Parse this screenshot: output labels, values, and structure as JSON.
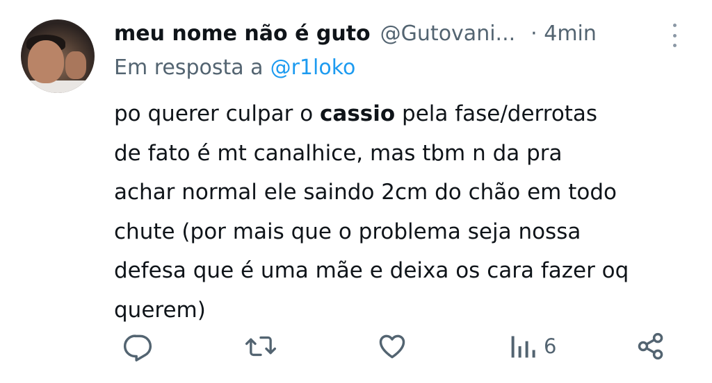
{
  "tweet": {
    "author_name": "meu nome não é guto",
    "author_handle": "@Gutovani...",
    "time": "· 4min",
    "reply_prefix": "Em resposta a",
    "reply_to": "@r1loko",
    "text_lines": [
      {
        "parts": [
          {
            "t": "po querer culpar o ",
            "bold": false
          },
          {
            "t": "cassio",
            "bold": true
          },
          {
            "t": " pela fase/derrotas",
            "bold": false
          }
        ]
      },
      {
        "parts": [
          {
            "t": "de fato é mt canalhice, mas tbm n da pra",
            "bold": false
          }
        ]
      },
      {
        "parts": [
          {
            "t": "achar normal ele saindo 2cm do chão em todo",
            "bold": false
          }
        ]
      },
      {
        "parts": [
          {
            "t": "chute (por mais que o problema seja nossa",
            "bold": false
          }
        ]
      },
      {
        "parts": [
          {
            "t": "defesa que é uma mãe e deixa os cara fazer oq",
            "bold": false
          }
        ]
      },
      {
        "parts": [
          {
            "t": "querem)",
            "bold": false
          }
        ]
      }
    ]
  },
  "actions": {
    "reply_icon": "reply-icon",
    "retweet_icon": "retweet-icon",
    "like_icon": "heart-icon",
    "views_icon": "views-icon",
    "views_count": "6",
    "share_icon": "share-icon"
  },
  "colors": {
    "text": "#0f1419",
    "secondary": "#536471",
    "link": "#1d9bf0"
  }
}
